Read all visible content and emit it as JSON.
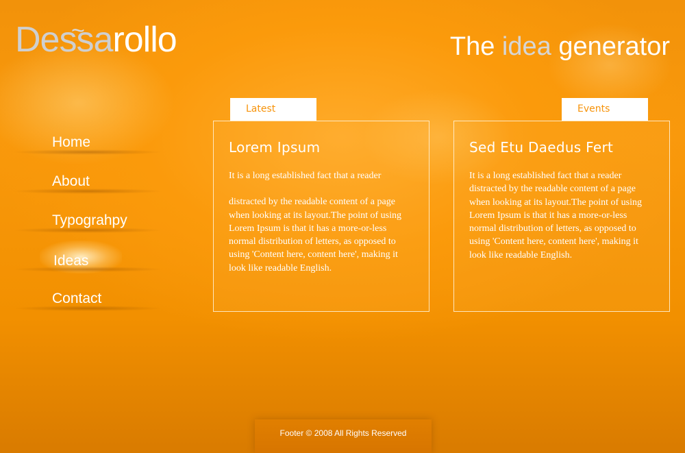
{
  "header": {
    "logo": {
      "part1": "De",
      "part2": "ssa",
      "part3": "rollo",
      "tilde": "~"
    },
    "tagline": {
      "word1": "The",
      "word2": "idea",
      "word3": "generator"
    }
  },
  "nav": {
    "items": [
      {
        "label": "Home"
      },
      {
        "label": "About"
      },
      {
        "label": "Typograhpy"
      },
      {
        "label": "Ideas",
        "active": true
      },
      {
        "label": "Contact"
      }
    ]
  },
  "tabs": {
    "latest": "Latest",
    "events": "Events"
  },
  "panels": {
    "latest": {
      "title": "Lorem Ipsum",
      "para1": "It is a long established fact that a reader",
      "para2": "distracted by the readable content of a page when looking at its layout.The point of using Lorem Ipsum is that it has a more-or-less normal distribution of letters, as opposed to using 'Content here, content here', making it look like readable English."
    },
    "events": {
      "title": "Sed Etu Daedus Fert",
      "para1": "It is a long established fact that a reader distracted by the readable content of a page when looking at its layout.The point of using Lorem Ipsum is that it has a more-or-less normal distribution of letters, as opposed to using 'Content here, content here', making it look like readable English."
    }
  },
  "footer": {
    "text": "Footer © 2008 All Rights Reserved"
  },
  "colors": {
    "background": "#f99a0c",
    "accent": "#f7930a",
    "grey_text": "#cfcfcf"
  }
}
